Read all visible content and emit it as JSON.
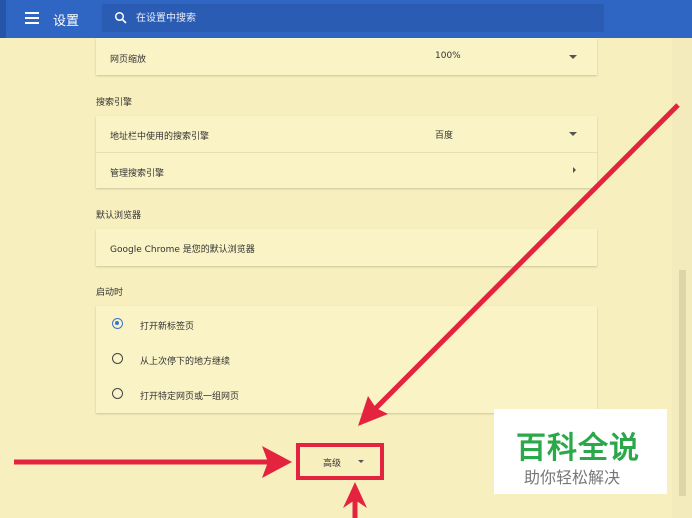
{
  "header": {
    "title": "设置",
    "search_placeholder": "在设置中搜索"
  },
  "appearance": {
    "zoom_label": "网页缩放",
    "zoom_value": "100%"
  },
  "search_engine": {
    "heading": "搜索引擎",
    "address_bar_label": "地址栏中使用的搜索引擎",
    "address_bar_value": "百度",
    "manage_label": "管理搜索引擎"
  },
  "default_browser": {
    "heading": "默认浏览器",
    "status": "Google Chrome 是您的默认浏览器"
  },
  "on_startup": {
    "heading": "启动时",
    "options": [
      {
        "label": "打开新标签页",
        "checked": true
      },
      {
        "label": "从上次停下的地方继续",
        "checked": false
      },
      {
        "label": "打开特定网页或一组网页",
        "checked": false
      }
    ]
  },
  "advanced": {
    "label": "高级"
  },
  "watermark": {
    "title": "百科全说",
    "subtitle": "助你轻松解决"
  },
  "colors": {
    "header_blue": "#2f66c3",
    "background": "#f7efbe",
    "annotation_red": "#e4233f",
    "watermark_green": "#2aa84a"
  }
}
